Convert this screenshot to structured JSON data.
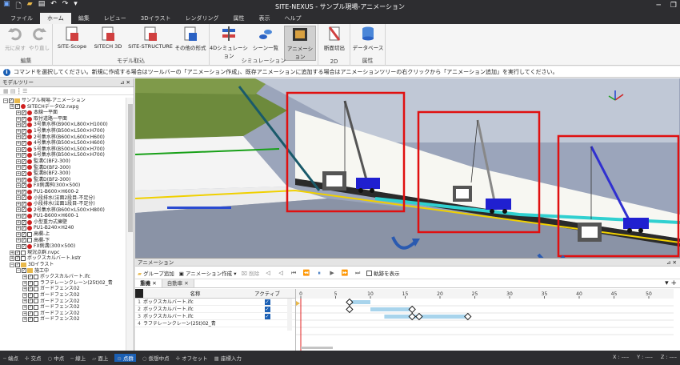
{
  "window": {
    "title": "SITE-NEXUS - サンプル現場-アニメーション",
    "minimize": "─",
    "restore": "❐"
  },
  "tabs": [
    "ファイル",
    "ホーム",
    "編集",
    "レビュー",
    "3Dイラスト",
    "レンダリング",
    "属性",
    "表示",
    "ヘルプ"
  ],
  "ribbon": {
    "groups": {
      "edit": "編集",
      "model": "モデル取込",
      "sim": "シミュレーション",
      "twod": "2D",
      "attr": "属性"
    },
    "buttons": {
      "undo": "元に戻す",
      "redo": "やり直し",
      "site_scope": "SITE-Scope",
      "sitech3d": "SITECH 3D",
      "site_structure": "SITE-STRUCTURE",
      "other": "その他の形式",
      "sim4d": "4Dシミュレーション",
      "scene": "シーン一覧",
      "animation": "アニメーション",
      "section": "断面切出",
      "database": "データベース"
    }
  },
  "message": "コマンドを選択してください。新規に作成する場合はツールバーの「アニメーション作成」、既存アニメーションに追加する場合はアニメーションツリーの右クリックから「アニメーション追加」を実行してください。",
  "tree": {
    "title": "モデルツリー",
    "items": [
      {
        "label": "サンプル現場-アニメーション",
        "level": 0,
        "icon": "root"
      },
      {
        "label": "SITECHデータ02.nxpg",
        "level": 1,
        "icon": "red"
      },
      {
        "label": "本線一平面",
        "level": 2,
        "icon": "red"
      },
      {
        "label": "取付道路一平面",
        "level": 2,
        "icon": "red"
      },
      {
        "label": "3号集水桝(B900×L800×H1000)",
        "level": 2,
        "icon": "red"
      },
      {
        "label": "1号集水桝(B500×L500×H700)",
        "level": 2,
        "icon": "red"
      },
      {
        "label": "2号集水桝(B600×L600×H600)",
        "level": 2,
        "icon": "red"
      },
      {
        "label": "4号集水桝(B500×L500×H600)",
        "level": 2,
        "icon": "red"
      },
      {
        "label": "5号集水桝(B500×L500×H700)",
        "level": 2,
        "icon": "red"
      },
      {
        "label": "6号集水桝(B500×L500×H700)",
        "level": 2,
        "icon": "red"
      },
      {
        "label": "監溝C(BF2-300)",
        "level": 2,
        "icon": "red"
      },
      {
        "label": "監溝D(BF2-300)",
        "level": 2,
        "icon": "red"
      },
      {
        "label": "監溝B(BF2-300)",
        "level": 2,
        "icon": "red"
      },
      {
        "label": "監溝D(BF2-300)",
        "level": 2,
        "icon": "red"
      },
      {
        "label": "FX側溝桝(300×500)",
        "level": 2,
        "icon": "red"
      },
      {
        "label": "PU1-B600×H600-2",
        "level": 2,
        "icon": "red"
      },
      {
        "label": "小段排水(法面2段目-不足分)",
        "level": 2,
        "icon": "red"
      },
      {
        "label": "小段排水(法面1段目-不足分)",
        "level": 2,
        "icon": "red"
      },
      {
        "label": "2号集水桝(B600×L500×H800)",
        "level": 2,
        "icon": "red"
      },
      {
        "label": "PU1-B600×H600-1",
        "level": 2,
        "icon": "red"
      },
      {
        "label": "小型重力式擁壁",
        "level": 2,
        "icon": "red"
      },
      {
        "label": "PU1-B240×H240",
        "level": 2,
        "icon": "red"
      },
      {
        "label": "高欄-上",
        "level": 2,
        "icon": "empty"
      },
      {
        "label": "高欄-下",
        "level": 2,
        "icon": "empty"
      },
      {
        "label": "FX側溝(300×500)",
        "level": 2,
        "icon": "red"
      },
      {
        "label": "現況点群.nvpc",
        "level": 1,
        "icon": "empty"
      },
      {
        "label": "ボックスカルバート.kstr",
        "level": 1,
        "icon": "empty"
      },
      {
        "label": "3Dイラスト",
        "level": 1,
        "icon": "folder"
      },
      {
        "label": "施工中",
        "level": 2,
        "icon": "folder"
      },
      {
        "label": "ボックスカルバート.ifc",
        "level": 3,
        "icon": "file"
      },
      {
        "label": "ラフテレーンクレーン(25t)02_青",
        "level": 3,
        "icon": "file"
      },
      {
        "label": "ガードフェンス02",
        "level": 3,
        "icon": "file"
      },
      {
        "label": "ガードフェンス02",
        "level": 3,
        "icon": "file"
      },
      {
        "label": "ガードフェンス02",
        "level": 3,
        "icon": "file"
      },
      {
        "label": "ガードフェンス02",
        "level": 3,
        "icon": "file"
      },
      {
        "label": "ガードフェンス02",
        "level": 3,
        "icon": "file"
      },
      {
        "label": "ガードフェンス02",
        "level": 3,
        "icon": "file"
      }
    ]
  },
  "animation": {
    "title": "アニメーション",
    "group_add": "グループ追加",
    "create": "アニメーション作成",
    "delete": "削除",
    "trajectory": "軌跡を表示",
    "tabs": [
      "重機",
      "自動車"
    ],
    "columns": {
      "name": "名称",
      "active": "アクティブ"
    },
    "rows": [
      {
        "no": "1",
        "name": "ボックスカルバート.ifc"
      },
      {
        "no": "2",
        "name": "ボックスカルバート.ifc"
      },
      {
        "no": "3",
        "name": "ボックスカルバート.ifc"
      },
      {
        "no": "4",
        "name": "ラフテレーンクレーン(25t)02_青"
      }
    ],
    "ticks": [
      "0",
      "5",
      "10",
      "15",
      "20",
      "25",
      "30",
      "35",
      "40",
      "45",
      "50",
      "55"
    ]
  },
  "status": {
    "items": [
      "端点",
      "交点",
      "中点",
      "線上",
      "面上",
      "点群",
      "仮想中点",
      "オフセット",
      "座標入力"
    ],
    "selected": "点群",
    "x": "X : ----",
    "y": "Y : ----",
    "z": "Z : ----"
  }
}
